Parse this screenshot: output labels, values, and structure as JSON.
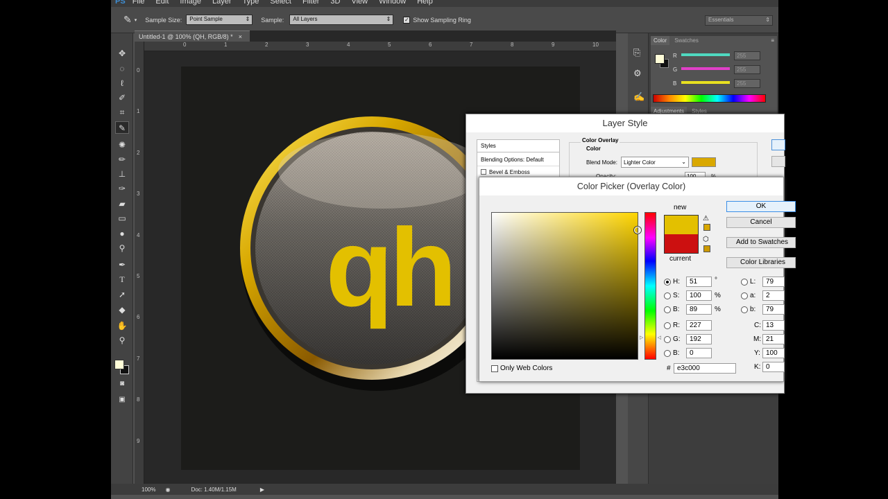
{
  "menu": {
    "logo": "PS",
    "items": [
      "File",
      "Edit",
      "Image",
      "Layer",
      "Type",
      "Select",
      "Filter",
      "3D",
      "View",
      "Window",
      "Help"
    ]
  },
  "options": {
    "sample_size_label": "Sample Size:",
    "sample_size_value": "Point Sample",
    "sample_label": "Sample:",
    "sample_value": "All Layers",
    "show_ring_label": "Show Sampling Ring",
    "show_ring_checked": true,
    "workspace": "Essentials"
  },
  "document": {
    "tab_title": "Untitled-1 @ 100% (QH, RGB/8) *",
    "ruler_top": [
      "0",
      "1",
      "2",
      "3",
      "4",
      "5",
      "6",
      "7",
      "8",
      "9",
      "10"
    ],
    "ruler_left": [
      "0",
      "1",
      "2",
      "3",
      "4",
      "5",
      "6",
      "7",
      "8",
      "9"
    ],
    "artwork_text": "qh",
    "zoom": "100%",
    "doc_size": "Doc: 1.40M/1.15M"
  },
  "color_panel": {
    "tabs": [
      "Color",
      "Swatches"
    ],
    "channels": [
      {
        "label": "R",
        "value": "255",
        "color": "#4fd9c0"
      },
      {
        "label": "G",
        "value": "255",
        "color": "#e040c8"
      },
      {
        "label": "B",
        "value": "255",
        "color": "#e8e020"
      }
    ],
    "lower_tabs": [
      "Adjustments",
      "Styles"
    ]
  },
  "layer_style": {
    "title": "Layer Style",
    "sidebar": [
      "Styles",
      "Blending Options: Default",
      "Bevel & Emboss"
    ],
    "section_title": "Color Overlay",
    "group_label": "Color",
    "blend_mode_label": "Blend Mode:",
    "blend_mode_value": "Lighter Color",
    "overlay_color": "#d9a800",
    "opacity_label": "Opacity:",
    "opacity_value": "100",
    "opacity_unit": "%"
  },
  "color_picker": {
    "title": "Color Picker (Overlay Color)",
    "new_label": "new",
    "current_label": "current",
    "new_color": "#e3c000",
    "current_color": "#cc1010",
    "buttons": [
      "OK",
      "Cancel",
      "Add to Swatches",
      "Color Libraries"
    ],
    "only_web_colors": "Only Web Colors",
    "hue_color": "#ffd500",
    "hsb": [
      {
        "label": "H:",
        "value": "51",
        "unit": "°",
        "selected": true
      },
      {
        "label": "S:",
        "value": "100",
        "unit": "%",
        "selected": false
      },
      {
        "label": "B:",
        "value": "89",
        "unit": "%",
        "selected": false
      }
    ],
    "rgb": [
      {
        "label": "R:",
        "value": "227"
      },
      {
        "label": "G:",
        "value": "192"
      },
      {
        "label": "B:",
        "value": "0"
      }
    ],
    "lab": [
      {
        "label": "L:",
        "value": "79"
      },
      {
        "label": "a:",
        "value": "2"
      },
      {
        "label": "b:",
        "value": "79"
      }
    ],
    "cmyk": [
      {
        "label": "C:",
        "value": "13"
      },
      {
        "label": "M:",
        "value": "21"
      },
      {
        "label": "Y:",
        "value": "100"
      },
      {
        "label": "K:",
        "value": "0"
      }
    ],
    "hex_label": "#",
    "hex_value": "e3c000"
  }
}
